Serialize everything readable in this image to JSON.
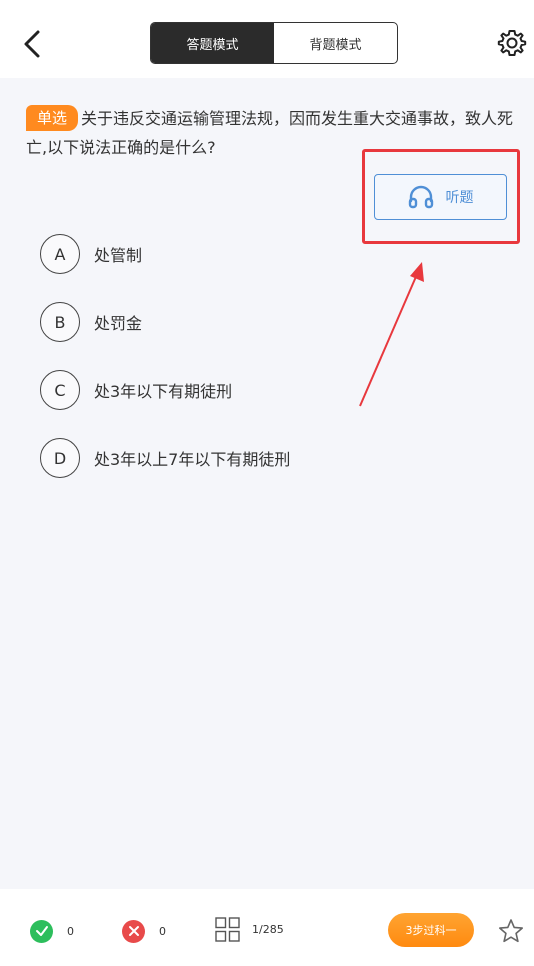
{
  "header": {
    "back_icon": "chevron-left-icon",
    "mode_tabs": [
      {
        "label": "答题模式",
        "active": true
      },
      {
        "label": "背题模式",
        "active": false
      }
    ],
    "settings_icon": "gear-icon"
  },
  "question": {
    "type_badge": "单选",
    "text": "关于违反交通运输管理法规，因而发生重大交通事故，致人死亡,以下说法正确的是什么?"
  },
  "listen_button": {
    "icon": "headphones-icon",
    "label": "听题"
  },
  "options": [
    {
      "letter": "A",
      "text": "处管制"
    },
    {
      "letter": "B",
      "text": "处罚金"
    },
    {
      "letter": "C",
      "text": "处3年以下有期徒刑"
    },
    {
      "letter": "D",
      "text": "处3年以上7年以下有期徒刑"
    }
  ],
  "bottom_bar": {
    "correct_count": "0",
    "wrong_count": "0",
    "progress": "1/285",
    "step_button": "3步过科一",
    "favorite_icon": "star-icon"
  },
  "colors": {
    "accent_orange": "#ff8a1f",
    "listen_blue": "#4f8fd6",
    "highlight_red": "#e8383d",
    "correct_green": "#2dbe5c",
    "wrong_red": "#e84a4a"
  }
}
